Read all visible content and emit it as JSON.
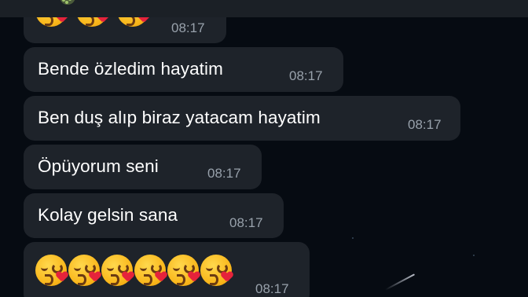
{
  "chat": {
    "messages": [
      {
        "kind": "emoji",
        "text": "",
        "emoji_count": 3,
        "emoji_icon": "kissing-heart-emoji-icon",
        "time": "08:17"
      },
      {
        "kind": "text",
        "text": "Bende özledim hayatim",
        "time": "08:17"
      },
      {
        "kind": "text",
        "text": "Ben duş alıp biraz yatacam hayatim",
        "time": "08:17"
      },
      {
        "kind": "text",
        "text": "Öpüyorum seni",
        "time": "08:17"
      },
      {
        "kind": "text",
        "text": "Kolay gelsin sana",
        "time": "08:17"
      },
      {
        "kind": "emoji",
        "text": "",
        "emoji_count": 6,
        "emoji_icon": "kissing-heart-emoji-icon",
        "time": "08:17"
      }
    ]
  },
  "colors": {
    "background": "#060b12",
    "bubble": "#1e232a",
    "time_text": "#98a1ab",
    "message_text": "#ffffff",
    "emoji_face": "#f9b61a",
    "emoji_heart": "#e5233b"
  }
}
